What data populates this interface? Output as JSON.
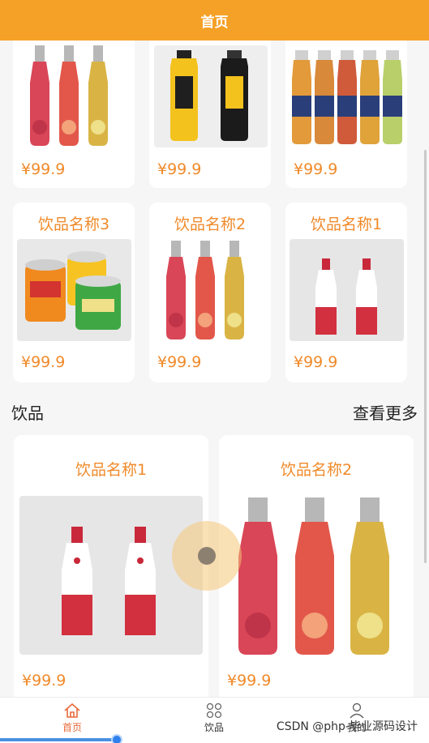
{
  "header": {
    "title": "首页"
  },
  "top_row": [
    {
      "price": "¥99.9",
      "image": "fruit-bottles-image"
    },
    {
      "price": "¥99.9",
      "image": "yellow-black-bottles-image"
    },
    {
      "price": "¥99.9",
      "image": "tea-bottles-image"
    }
  ],
  "second_row": [
    {
      "name": "饮品名称3",
      "price": "¥99.9",
      "image": "soda-cans-image"
    },
    {
      "name": "饮品名称2",
      "price": "¥99.9",
      "image": "fruit-bottles-image"
    },
    {
      "name": "饮品名称1",
      "price": "¥99.9",
      "image": "red-white-bottles-image"
    }
  ],
  "section": {
    "title": "饮品",
    "more": "查看更多"
  },
  "featured": [
    {
      "name": "饮品名称1",
      "price": "¥99.9",
      "image": "red-white-bottles-image"
    },
    {
      "name": "饮品名称2",
      "price": "¥99.9",
      "image": "fruit-bottles-image"
    }
  ],
  "tabbar": {
    "items": [
      {
        "label": "首页",
        "icon": "home-icon",
        "active": true
      },
      {
        "label": "饮品",
        "icon": "grid-icon",
        "active": false
      },
      {
        "label": "我的",
        "icon": "user-icon",
        "active": false
      }
    ]
  },
  "watermark": "CSDN @php-毕业源码设计",
  "colors": {
    "accent": "#f5a127",
    "price": "#f08a2a",
    "active_tab": "#e86a3a"
  }
}
